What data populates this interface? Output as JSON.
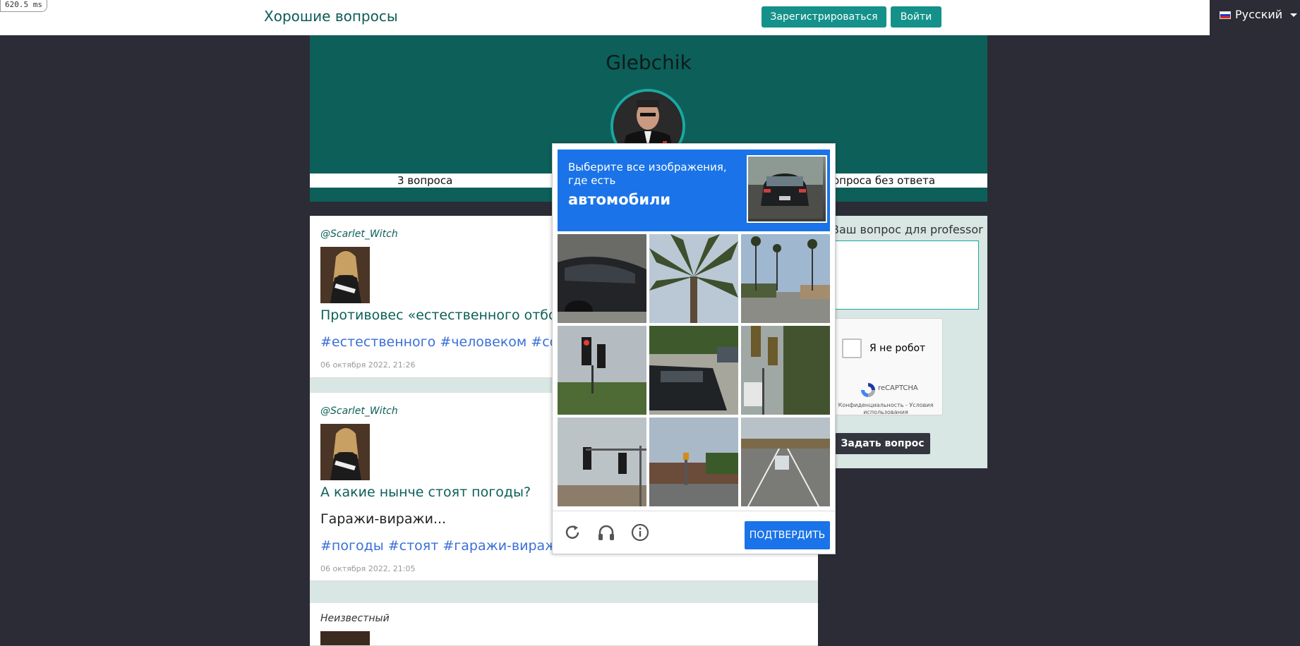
{
  "timer": "620.5 ms",
  "header": {
    "brand": "Хорошие вопросы",
    "register_label": "Зарегистрироваться",
    "login_label": "Войти",
    "language": "Русский"
  },
  "profile": {
    "name": "Glebchik",
    "stat_questions": "3 вопроса",
    "stat_unanswered": "опроса без ответа"
  },
  "feed": {
    "items": [
      {
        "author": "@Scarlet_Witch",
        "title": "Противовес «естественного отбора",
        "tags": "#естественного #человеком #созда",
        "date": "06 октября 2022, 21:26"
      },
      {
        "author": "@Scarlet_Witch",
        "title": "А какие нынче стоят погоды?",
        "body": "Гаражи-виражи...",
        "tags": "#погоды #стоят #гаражи-виражи",
        "date": "06 октября 2022, 21:05"
      },
      {
        "author": "Неизвестный"
      }
    ]
  },
  "ask_form": {
    "label": "Ваш вопрос для professor",
    "recaptcha": {
      "not_robot": "Я не робот",
      "brand": "reCAPTCHA",
      "privacy": "Конфиденциальность - Условия использования"
    },
    "submit_label": "Задать вопрос"
  },
  "captcha": {
    "instruction": "Выберите все изображения, где есть",
    "target": "автомобили",
    "verify_label": "ПОДТВЕРДИТЬ",
    "tiles": [
      "car-door",
      "palm-tree",
      "palm-street",
      "traffic-light",
      "parked-car",
      "traffic-light-tree",
      "traffic-light-pole",
      "street-corner",
      "road-car"
    ]
  },
  "colors": {
    "teal_dark": "#0d5f59",
    "teal_button": "#14918a",
    "captcha_blue": "#1a73e8",
    "background": "#2c2c36"
  }
}
